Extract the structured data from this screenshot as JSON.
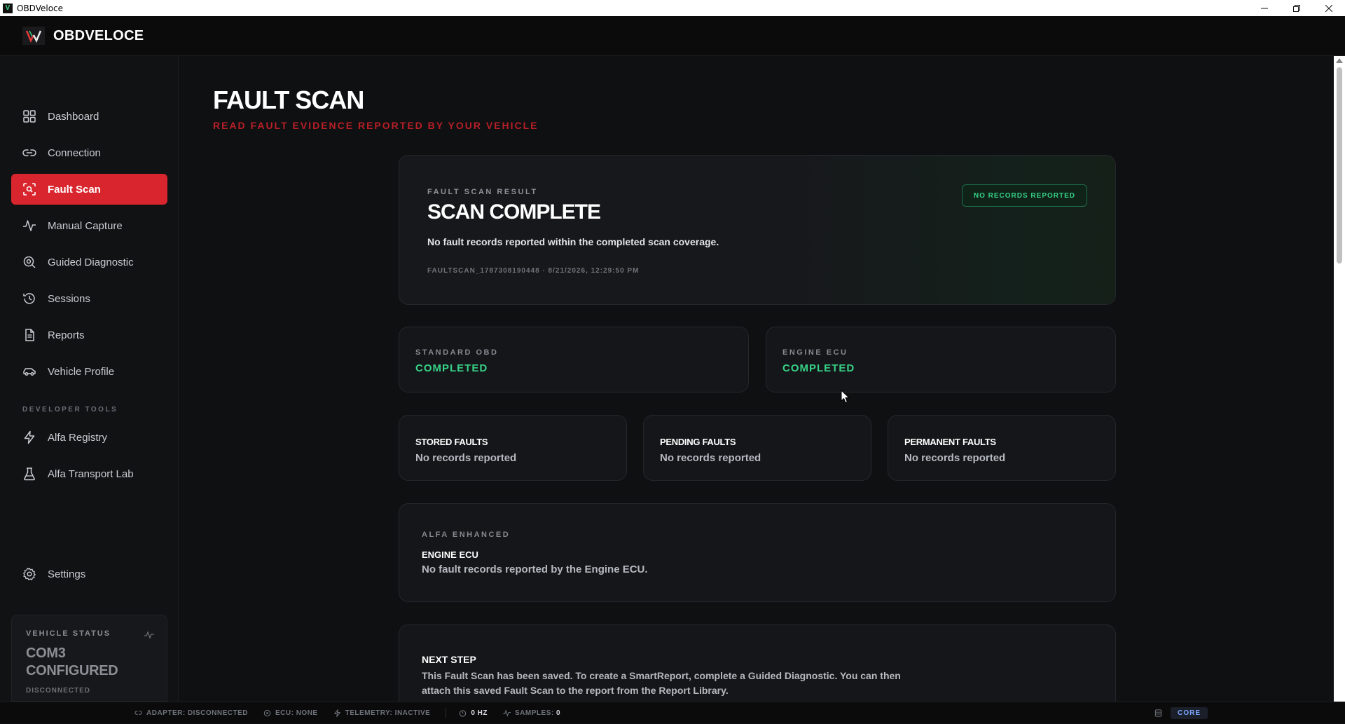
{
  "window": {
    "title": "OBDVeloce",
    "app_icon_glyph": "V"
  },
  "header": {
    "logo_text": "OBDVELOCE"
  },
  "sidebar": {
    "items": [
      {
        "label": "Dashboard",
        "icon": "grid-icon"
      },
      {
        "label": "Connection",
        "icon": "link-icon"
      },
      {
        "label": "Fault Scan",
        "icon": "scan-icon",
        "active": true
      },
      {
        "label": "Manual Capture",
        "icon": "pulse-icon"
      },
      {
        "label": "Guided Diagnostic",
        "icon": "search-icon"
      },
      {
        "label": "Sessions",
        "icon": "history-icon"
      },
      {
        "label": "Reports",
        "icon": "document-icon"
      },
      {
        "label": "Vehicle Profile",
        "icon": "car-icon"
      }
    ],
    "developer_label": "DEVELOPER TOOLS",
    "developer_items": [
      {
        "label": "Alfa Registry",
        "icon": "bolt-icon"
      },
      {
        "label": "Alfa Transport Lab",
        "icon": "flask-icon"
      }
    ],
    "settings_label": "Settings",
    "vehicle_status": {
      "label": "VEHICLE STATUS",
      "value_line1": "COM3",
      "value_line2": "CONFIGURED",
      "sub": "DISCONNECTED"
    }
  },
  "page": {
    "title": "FAULT SCAN",
    "subtitle": "READ FAULT EVIDENCE REPORTED BY YOUR VEHICLE"
  },
  "result": {
    "label": "FAULT SCAN RESULT",
    "heading": "SCAN COMPLETE",
    "description": "No fault records reported within the completed scan coverage.",
    "meta": "FAULTSCAN_1787308190448 · 8/21/2026, 12:29:50 PM",
    "badge": "NO RECORDS REPORTED"
  },
  "coverage": [
    {
      "label": "STANDARD OBD",
      "value": "COMPLETED"
    },
    {
      "label": "ENGINE ECU",
      "value": "COMPLETED"
    }
  ],
  "faults": [
    {
      "label": "STORED FAULTS",
      "value": "No records reported"
    },
    {
      "label": "PENDING FAULTS",
      "value": "No records reported"
    },
    {
      "label": "PERMANENT FAULTS",
      "value": "No records reported"
    }
  ],
  "enhanced": {
    "label": "ALFA ENHANCED",
    "heading": "ENGINE ECU",
    "description": "No fault records reported by the Engine ECU."
  },
  "next_step": {
    "heading": "NEXT STEP",
    "description": "This Fault Scan has been saved. To create a SmartReport, complete a Guided Diagnostic. You can then attach this saved Fault Scan to the report from the Report Library."
  },
  "statusbar": {
    "adapter_label": "ADAPTER:",
    "adapter_value": "DISCONNECTED",
    "ecu_label": "ECU:",
    "ecu_value": "NONE",
    "telemetry_label": "TELEMETRY:",
    "telemetry_value": "INACTIVE",
    "hz_value": "0 HZ",
    "samples_label": "SAMPLES:",
    "samples_value": "0",
    "core_label": "CORE"
  },
  "colors": {
    "accent_red": "#d9262e",
    "success_green": "#37d287",
    "background": "#0f1012"
  }
}
